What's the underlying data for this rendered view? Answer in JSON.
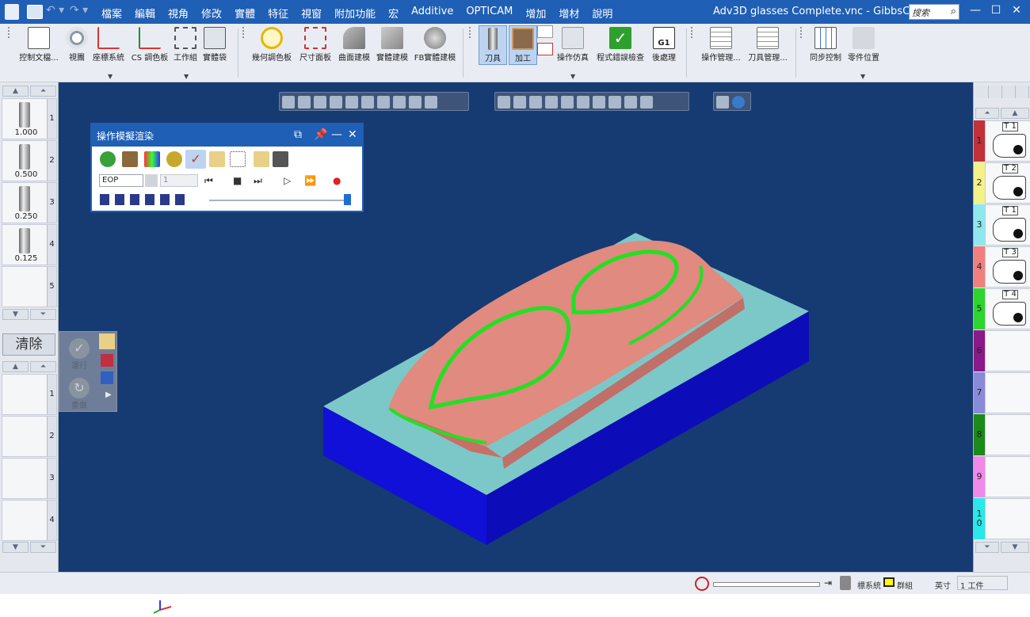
{
  "window": {
    "title": "Adv3D glasses Complete.vnc - GibbsCAM",
    "search_placeholder": "搜索"
  },
  "menu": [
    "檔案",
    "編輯",
    "視角",
    "修改",
    "實體",
    "特征",
    "視窗",
    "附加功能",
    "宏",
    "Additive",
    "OPTICAM",
    "增加",
    "增材",
    "說明"
  ],
  "toolbar": {
    "groups": [
      {
        "label": "控制文檔...",
        "icon": "document-control-icon"
      },
      {
        "label": "視團",
        "icon": "view-icon"
      },
      {
        "label": "座標系統",
        "icon": "coordinate-system-icon"
      },
      {
        "label": "CS 調色板",
        "icon": "cs-palette-icon"
      },
      {
        "label": "工作組",
        "icon": "workgroup-icon"
      },
      {
        "label": "實體袋",
        "icon": "solid-bag-icon"
      },
      {
        "label": "幾何調色板",
        "icon": "geometry-palette-icon"
      },
      {
        "label": "尺寸面板",
        "icon": "dimension-panel-icon"
      },
      {
        "label": "曲面建模",
        "icon": "surface-modeling-icon"
      },
      {
        "label": "實體建模",
        "icon": "solid-modeling-icon"
      },
      {
        "label": "FB實體建模",
        "icon": "fb-solid-modeling-icon"
      },
      {
        "label": "刀具",
        "icon": "tool-icon"
      },
      {
        "label": "加工",
        "icon": "machining-icon"
      },
      {
        "label": "操作仿真",
        "icon": "operation-simulation-icon"
      },
      {
        "label": "程式錯誤檢查",
        "icon": "program-error-check-icon"
      },
      {
        "label": "後處理",
        "icon": "post-process-icon"
      },
      {
        "label": "操作管理...",
        "icon": "operation-manager-icon"
      },
      {
        "label": "刀具管理...",
        "icon": "tool-manager-icon"
      },
      {
        "label": "同步控制",
        "icon": "sync-control-icon"
      },
      {
        "label": "零件位置",
        "icon": "part-position-icon"
      }
    ]
  },
  "left_tools": [
    {
      "num": "1",
      "size": "1.000"
    },
    {
      "num": "2",
      "size": "0.500"
    },
    {
      "num": "3",
      "size": "0.250"
    },
    {
      "num": "4",
      "size": "0.125"
    },
    {
      "num": "5",
      "size": ""
    }
  ],
  "clear_label": "清除",
  "do_redo": {
    "do_label": "運行",
    "redo_label": "重做"
  },
  "left_ops": [
    "1",
    "2",
    "3",
    "4"
  ],
  "sim_panel": {
    "title": "操作模擬渲染",
    "eop_value": "EOP",
    "step_value": "1"
  },
  "right_ops": [
    {
      "num": "1",
      "tool": "T 1",
      "color": "#c0313a"
    },
    {
      "num": "2",
      "tool": "T 2",
      "color": "#f4f08a"
    },
    {
      "num": "3",
      "tool": "T 1",
      "color": "#8ee8ee"
    },
    {
      "num": "4",
      "tool": "T 3",
      "color": "#f08080"
    },
    {
      "num": "5",
      "tool": "T 4",
      "color": "#2fd52f"
    },
    {
      "num": "6",
      "tool": "",
      "color": "#8a1a8a"
    },
    {
      "num": "7",
      "tool": "",
      "color": "#8a8ad8"
    },
    {
      "num": "8",
      "tool": "",
      "color": "#1a8a1a"
    },
    {
      "num": "9",
      "tool": "",
      "color": "#f08ae8"
    },
    {
      "num": "1\n0",
      "tool": "",
      "color": "#2ae8e8"
    }
  ],
  "status": {
    "coord_label": "標系統",
    "group_label": "群組",
    "unit_label": "英寸",
    "workpiece_label": "1 工件"
  }
}
